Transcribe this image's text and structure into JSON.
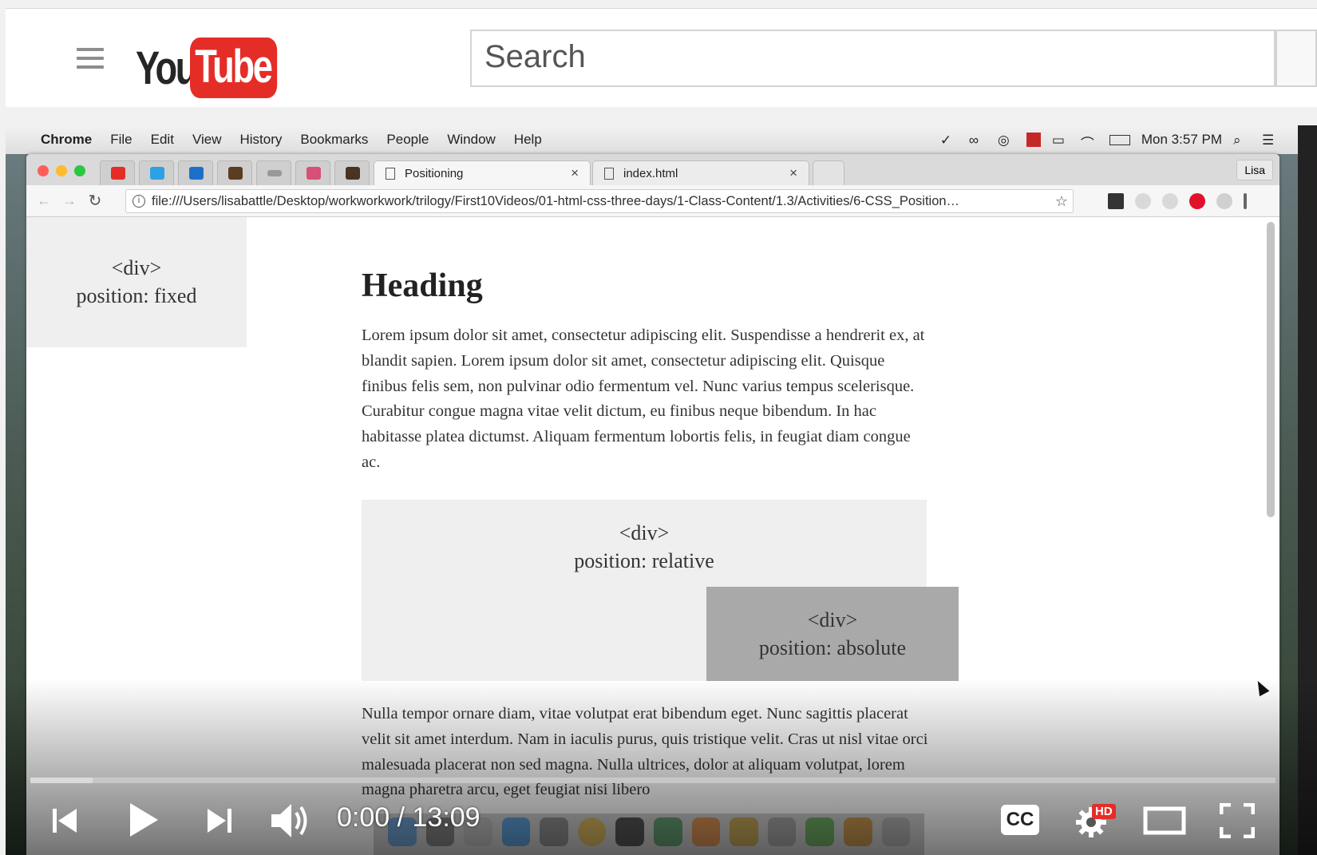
{
  "youtube": {
    "logo_you": "You",
    "logo_tube": "Tube",
    "search_placeholder": "Search"
  },
  "mac_menu": {
    "items": [
      "Chrome",
      "File",
      "Edit",
      "View",
      "History",
      "Bookmarks",
      "People",
      "Window",
      "Help"
    ],
    "clock": "Mon 3:57 PM"
  },
  "chrome": {
    "tabs": [
      {
        "title": "Positioning"
      },
      {
        "title": "index.html"
      }
    ],
    "profile": "Lisa",
    "url": "file:///Users/lisabattle/Desktop/workworkwork/trilogy/First10Videos/01-html-css-three-days/1-Class-Content/1.3/Activities/6-CSS_Position…"
  },
  "page": {
    "fixed_box": {
      "line1": "<div>",
      "line2": "position: fixed"
    },
    "heading": "Heading",
    "paragraph1": "Lorem ipsum dolor sit amet, consectetur adipiscing elit. Suspendisse a hendrerit ex, at blandit sapien. Lorem ipsum dolor sit amet, consectetur adipiscing elit. Quisque finibus felis sem, non pulvinar odio fermentum vel. Nunc varius tempus scelerisque. Curabitur congue magna vitae velit dictum, eu finibus neque bibendum. In hac habitasse platea dictumst. Aliquam fermentum lobortis felis, in feugiat diam congue ac.",
    "relative_box": {
      "line1": "<div>",
      "line2": "position: relative"
    },
    "absolute_box": {
      "line1": "<div>",
      "line2": "position: absolute"
    },
    "paragraph2": "Nulla tempor ornare diam, vitae volutpat erat bibendum eget. Nunc sagittis placerat velit sit amet interdum. Nam in iaculis purus, quis tristique velit. Cras ut nisl vitae orci malesuada placerat non sed magna. Nulla ultrices, dolor at aliquam volutpat, lorem magna pharetra arcu, eget feugiat nisi libero"
  },
  "player": {
    "time": "0:00 / 13:09",
    "progress_fraction": 0.05,
    "cc_label": "CC",
    "hd_badge": "HD"
  }
}
